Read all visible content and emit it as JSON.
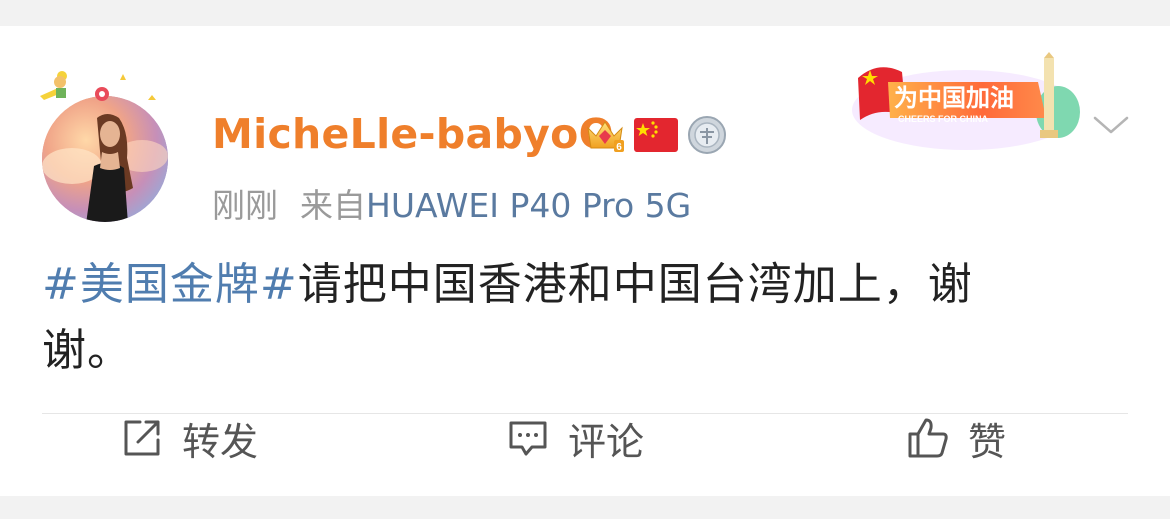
{
  "post": {
    "user": {
      "name": "MicheLle-babyoO",
      "badge_icons": [
        "crown-vip-6-icon",
        "china-flag-icon",
        "silver-medal-icon"
      ]
    },
    "meta": {
      "time": "刚刚",
      "source_prefix": "来自",
      "device": "HUAWEI P40 Pro 5G"
    },
    "promo_banner": {
      "title": "为中国加油",
      "subtitle": "CHEERS FOR CHINA"
    },
    "content": {
      "hashtag": "#美国金牌#",
      "text": "请把中国香港和中国台湾加上，谢谢。"
    }
  },
  "actions": {
    "repost_label": "转发",
    "comment_label": "评论",
    "like_label": "赞"
  },
  "colors": {
    "username": "#ef7f2b",
    "hashtag": "#507daf",
    "device": "#5a7aa0",
    "meta": "#9a9a9a",
    "text": "#222222"
  }
}
